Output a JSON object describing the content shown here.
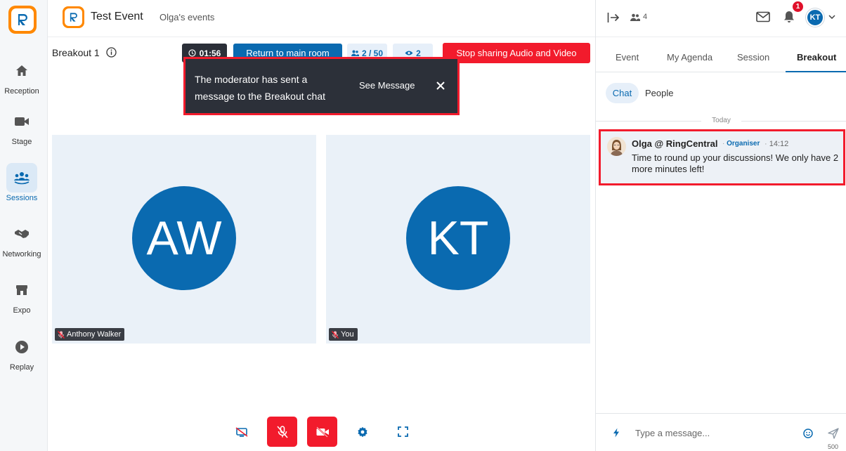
{
  "sidebar": {
    "items": [
      {
        "label": "Reception",
        "icon": "home-icon"
      },
      {
        "label": "Stage",
        "icon": "video-camera-icon"
      },
      {
        "label": "Sessions",
        "icon": "people-group-icon"
      },
      {
        "label": "Networking",
        "icon": "handshake-icon"
      },
      {
        "label": "Expo",
        "icon": "store-icon"
      },
      {
        "label": "Replay",
        "icon": "play-circle-icon"
      }
    ],
    "active": "Sessions"
  },
  "header": {
    "event_title": "Test Event",
    "events_link": "Olga's events"
  },
  "breakout": {
    "title": "Breakout 1",
    "timer": "01:56",
    "return_label": "Return to main room",
    "participant_count": "2 / 50",
    "viewer_count": "2",
    "stop_label": "Stop sharing Audio and Video"
  },
  "toast": {
    "message": "The moderator has sent a message to the Breakout chat",
    "action_label": "See Message"
  },
  "tiles": [
    {
      "initials": "AW",
      "name": "Anthony Walker"
    },
    {
      "initials": "KT",
      "name": "You"
    }
  ],
  "right_panel": {
    "attendee_count": "4",
    "notification_count": "1",
    "user_initials": "KT",
    "tabs": [
      "Event",
      "My Agenda",
      "Session",
      "Breakout"
    ],
    "active_tab": "Breakout",
    "subtabs": [
      "Chat",
      "People"
    ],
    "active_subtab": "Chat",
    "day_separator": "Today",
    "message": {
      "author": "Olga @ RingCentral",
      "role": "Organiser",
      "time": "14:12",
      "body": "Time to round up your discussions! We only have 2 more minutes left!"
    },
    "composer": {
      "placeholder": "Type a message...",
      "char_limit": "500"
    }
  },
  "colors": {
    "brand_blue": "#0a6ab0",
    "brand_orange": "#ff8800",
    "alert_red": "#f21b2c",
    "dark_toast": "#2c3039"
  }
}
